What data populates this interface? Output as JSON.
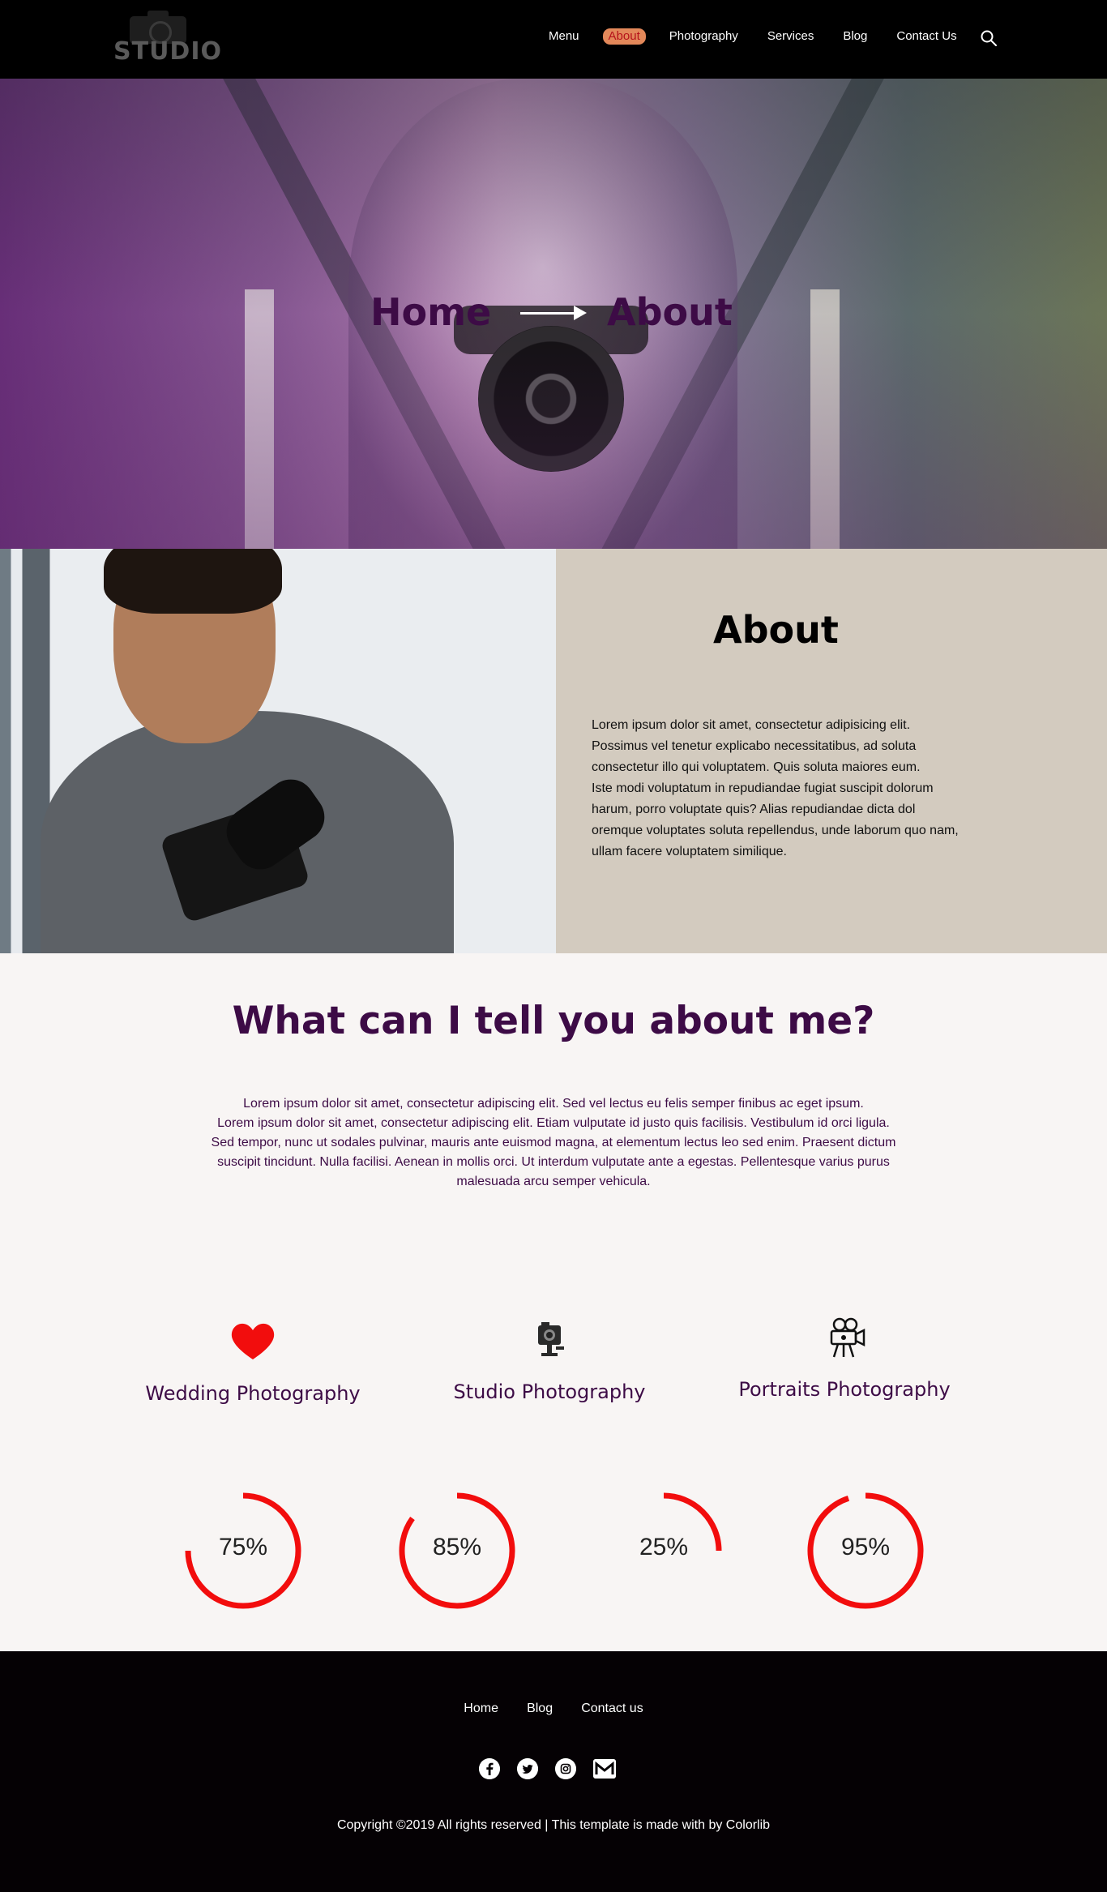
{
  "brand": {
    "logo_text": "STUDIO"
  },
  "nav": {
    "items": [
      {
        "label": "Menu",
        "active": false
      },
      {
        "label": "About",
        "active": true
      },
      {
        "label": "Photography",
        "active": false
      },
      {
        "label": "Services",
        "active": false
      },
      {
        "label": "Blog",
        "active": false
      },
      {
        "label": "Contact Us",
        "active": false
      }
    ],
    "search_icon": "search-icon"
  },
  "hero": {
    "crumb_home": "Home",
    "crumb_current": "About"
  },
  "about": {
    "title": "About",
    "body": "Lorem ipsum dolor sit amet, consectetur adipisicing elit.\nPossimus vel tenetur explicabo necessitatibus, ad soluta\n consectetur illo qui voluptatem. Quis soluta maiores eum.\nIste modi voluptatum in repudiandae fugiat suscipit dolorum\nharum, porro voluptate quis? Alias repudiandae dicta dol\noremque voluptates soluta repellendus, unde laborum quo nam,\n ullam facere voluptatem similique."
  },
  "tell": {
    "title": "What can I tell you about me?",
    "body": "Lorem ipsum dolor sit amet, consectetur adipiscing elit. Sed vel lectus eu felis semper finibus ac eget ipsum.\nLorem ipsum dolor sit amet, consectetur adipiscing elit. Etiam vulputate id justo quis facilisis. Vestibulum id orci ligula.\nSed tempor, nunc ut sodales pulvinar, mauris ante euismod magna, at elementum lectus leo sed enim. Praesent dictum\nsuscipit tincidunt. Nulla facilisi. Aenean in mollis orci. Ut interdum vulputate ante a egestas. Pellentesque varius purus\nmalesuada arcu semper vehicula."
  },
  "services": [
    {
      "label": "Wedding Photography",
      "icon": "heart-icon"
    },
    {
      "label": "Studio Photography",
      "icon": "camera-icon"
    },
    {
      "label": "Portraits Photography",
      "icon": "movie-camera-icon"
    }
  ],
  "skills": [
    {
      "label": "75%",
      "value": 0.75
    },
    {
      "label": "85%",
      "value": 0.85
    },
    {
      "label": "25%",
      "value": 0.25
    },
    {
      "label": "95%",
      "value": 0.95
    }
  ],
  "colors": {
    "accent": "#f20d0d",
    "nav_active_bg": "#e3885a",
    "heading": "#3d0b46",
    "about_bg": "#d3cbbf",
    "footer_bg": "#050104"
  },
  "footer": {
    "links": [
      "Home",
      "Blog",
      "Contact us"
    ],
    "social": [
      "facebook-icon",
      "twitter-icon",
      "instagram-icon",
      "mail-icon"
    ],
    "copyright": "Copyright ©2019 All rights reserved | This template is made with  by Colorlib"
  }
}
